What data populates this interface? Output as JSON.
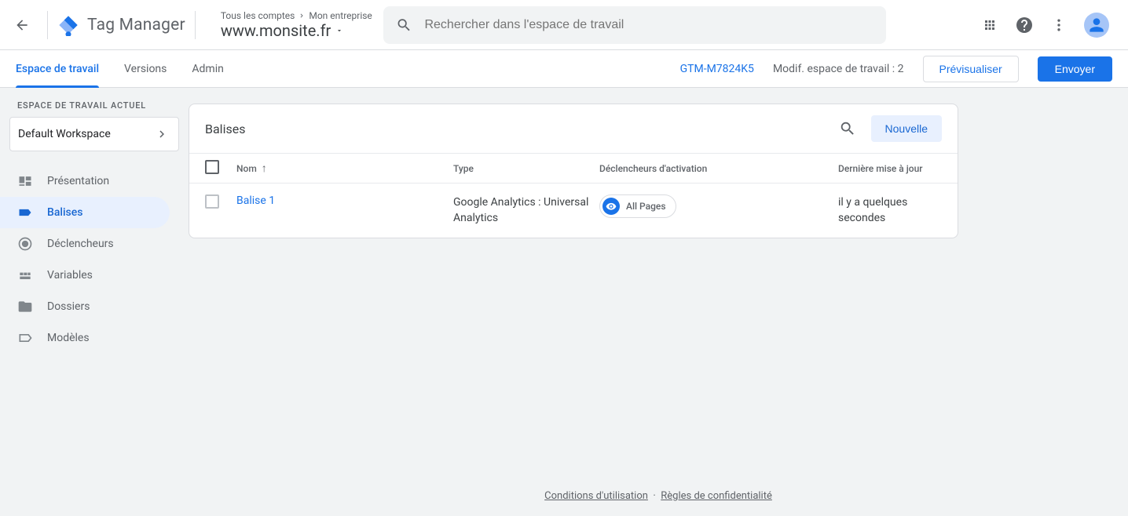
{
  "header": {
    "product": "Tag Manager",
    "breadcrumb": {
      "accounts": "Tous les comptes",
      "company": "Mon entreprise"
    },
    "container": "www.monsite.fr",
    "search_placeholder": "Rechercher dans l'espace de travail"
  },
  "subheader": {
    "tabs": {
      "workspace": "Espace de travail",
      "versions": "Versions",
      "admin": "Admin"
    },
    "container_id": "GTM-M7824K5",
    "workspace_changes": "Modif. espace de travail : 2",
    "preview": "Prévisualiser",
    "submit": "Envoyer"
  },
  "sidebar": {
    "current_label": "ESPACE DE TRAVAIL ACTUEL",
    "current_workspace": "Default Workspace",
    "items": {
      "overview": "Présentation",
      "tags": "Balises",
      "triggers": "Déclencheurs",
      "variables": "Variables",
      "folders": "Dossiers",
      "templates": "Modèles"
    }
  },
  "card": {
    "title": "Balises",
    "new_btn": "Nouvelle",
    "columns": {
      "name": "Nom",
      "type": "Type",
      "triggers": "Déclencheurs d'activation",
      "updated": "Dernière mise à jour"
    },
    "rows": [
      {
        "name": "Balise 1",
        "type": "Google Analytics : Universal Analytics",
        "trigger_chip": "All Pages",
        "updated": "il y a quelques secondes"
      }
    ]
  },
  "footer": {
    "terms": "Conditions d'utilisation",
    "privacy": "Règles de confidentialité",
    "sep": "·"
  }
}
